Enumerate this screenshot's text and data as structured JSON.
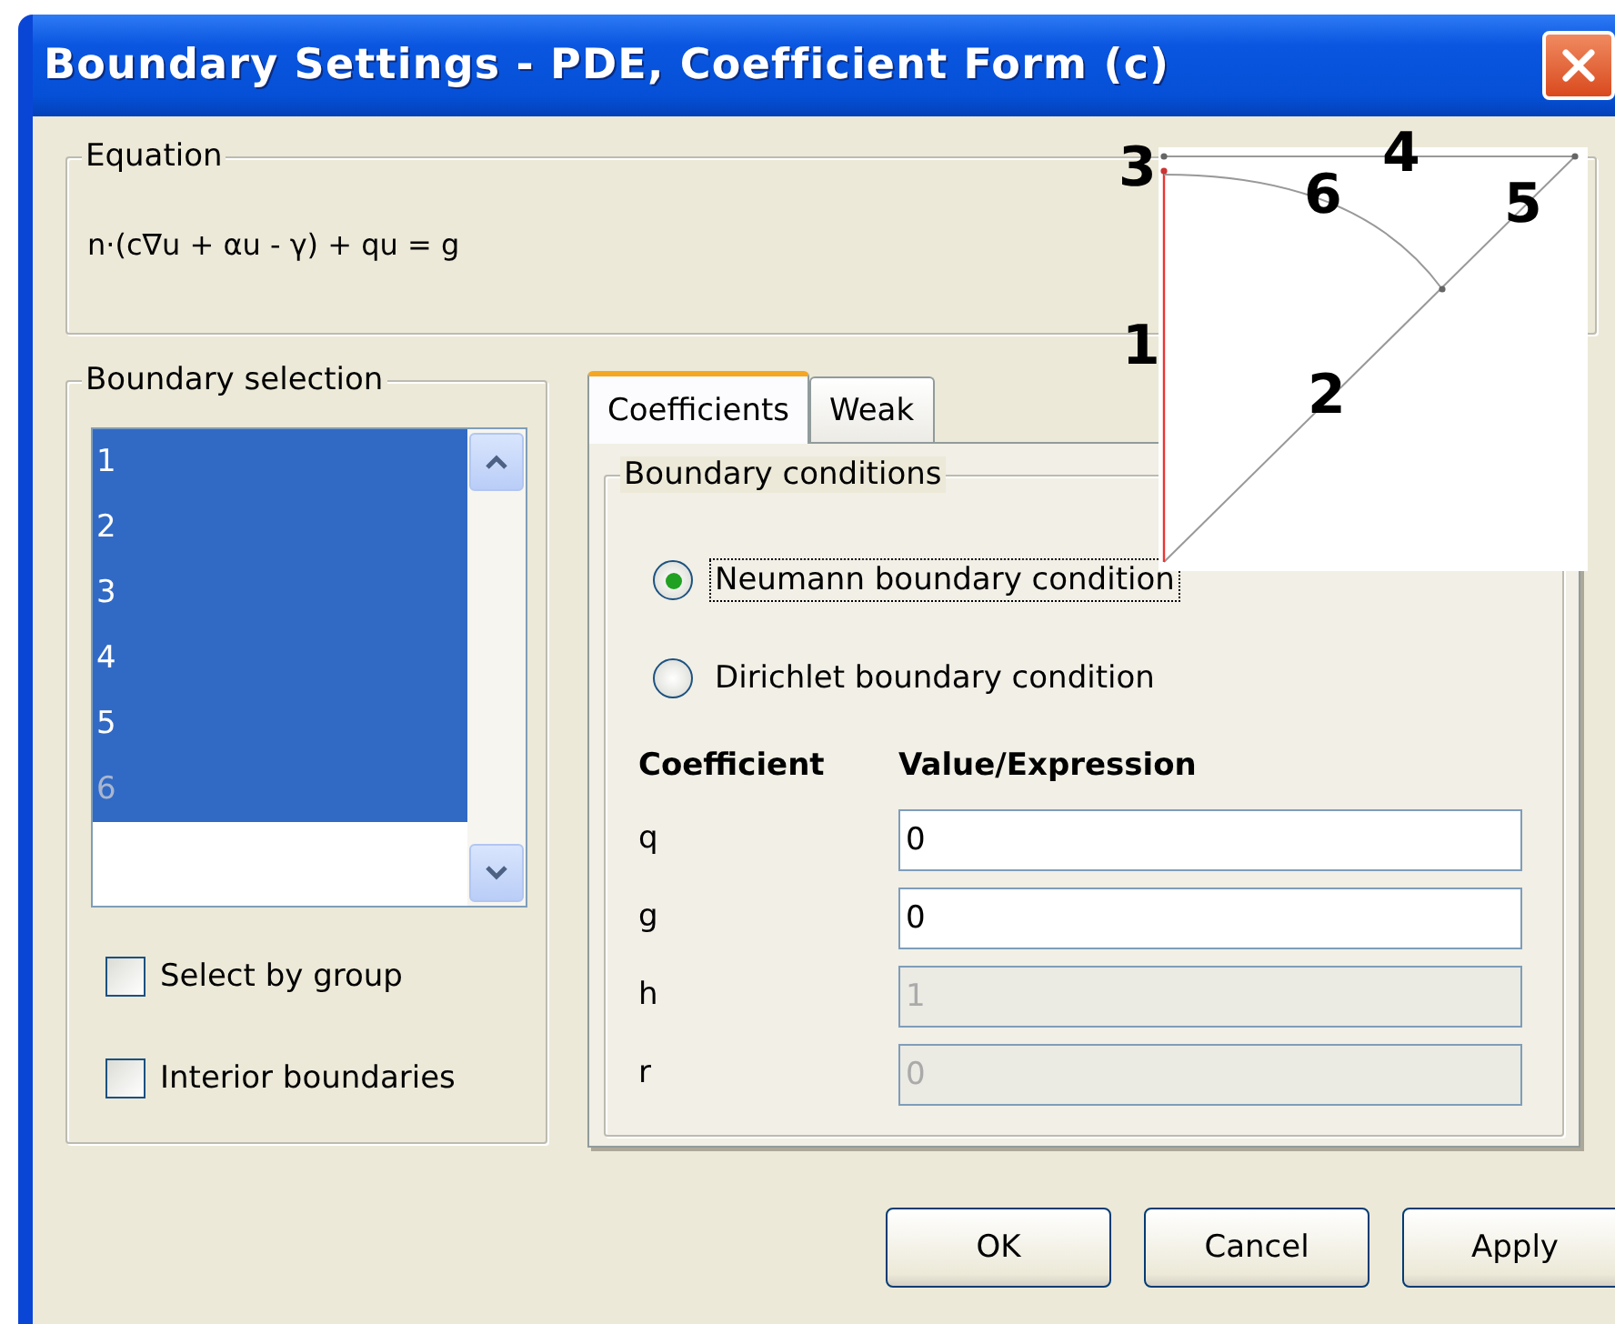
{
  "window": {
    "title": "Boundary Settings - PDE, Coefficient Form (c)"
  },
  "equation": {
    "label": "Equation",
    "text": "n·(c∇u + αu - γ) + qu = g"
  },
  "boundary_selection": {
    "label": "Boundary selection",
    "items": [
      {
        "label": "1",
        "selected": true,
        "disabled": false
      },
      {
        "label": "2",
        "selected": true,
        "disabled": false
      },
      {
        "label": "3",
        "selected": true,
        "disabled": false
      },
      {
        "label": "4",
        "selected": true,
        "disabled": false
      },
      {
        "label": "5",
        "selected": true,
        "disabled": false
      },
      {
        "label": "6",
        "selected": true,
        "disabled": true
      }
    ]
  },
  "checkboxes": [
    {
      "label": "Select by group",
      "checked": false
    },
    {
      "label": "Interior boundaries",
      "checked": false
    }
  ],
  "tabs": [
    {
      "label": "Coefficients",
      "selected": true
    },
    {
      "label": "Weak",
      "selected": false
    }
  ],
  "boundary_conditions": {
    "label": "Boundary conditions",
    "options": [
      {
        "label": "Neumann boundary condition",
        "selected": true,
        "focused": true
      },
      {
        "label": "Dirichlet boundary condition",
        "selected": false,
        "focused": false
      }
    ]
  },
  "coefficients": {
    "columns": [
      "Coefficient",
      "Value/Expression"
    ],
    "rows": [
      {
        "name": "q",
        "value": "0",
        "disabled": false
      },
      {
        "name": "g",
        "value": "0",
        "disabled": false
      },
      {
        "name": "h",
        "value": "1",
        "disabled": true
      },
      {
        "name": "r",
        "value": "0",
        "disabled": true
      }
    ]
  },
  "buttons": [
    "OK",
    "Cancel",
    "Apply"
  ],
  "geometry_overlay": {
    "labels": [
      "3",
      "4",
      "6",
      "5",
      "1",
      "2"
    ]
  }
}
